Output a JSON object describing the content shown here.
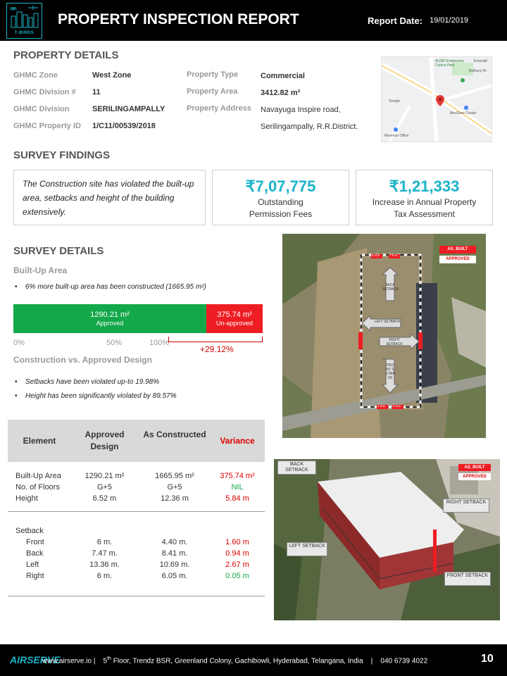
{
  "header": {
    "logo_text": "T-BIRDS",
    "title": "PROPERTY INSPECTION REPORT",
    "report_date_label": "Report Date:",
    "report_date": "19/01/2019"
  },
  "property_details": {
    "heading": "PROPERTY DETAILS",
    "left": [
      {
        "label": "GHMC Zone",
        "value": "West Zone"
      },
      {
        "label": "GHMC Division  #",
        "value": "11"
      },
      {
        "label": "GHMC Division",
        "value": "SERILINGAMPALLY"
      },
      {
        "label": "GHMC Property ID",
        "value": "1/C11/00539/2018"
      }
    ],
    "right": [
      {
        "label": "Property Type",
        "value": "Commercial"
      },
      {
        "label": "Property Area",
        "value": "3412.82 m²"
      },
      {
        "label": "Property Address",
        "value": "Navayuga Inspire road,",
        "value2": "Serilingampally, R.R.District."
      }
    ],
    "map": {
      "labels": [
        "ALIND Employees Colony Park",
        "Emerald",
        "Bethany Hi",
        "MedSave Center",
        "Revenue Office",
        "Temple"
      ]
    }
  },
  "survey_findings": {
    "heading": "SURVEY FINDINGS",
    "text": "The Construction  site has violated the built-up area,  setbacks and height of the building extensively.",
    "fees_value": "₹7,07,775",
    "fees_label_1": "Outstanding",
    "fees_label_2": "Permission Fees",
    "tax_value": "₹1,21,333",
    "tax_label_1": "Increase in Annual Property",
    "tax_label_2": "Tax Assessment"
  },
  "survey_details": {
    "heading": "SURVEY DETAILS",
    "built_up_title": "Built-Up  Area",
    "built_up_bullet": "6% more built-up area has been constructed  (1665.95 m²)",
    "bar": {
      "approved_value": "1290.21 m²",
      "approved_label": "Approved",
      "unapproved_value": "375.74 m²",
      "unapproved_label": "Un-approved",
      "approved_fraction": 0.774,
      "tick_0": "0%",
      "tick_50": "50%",
      "tick_100": "100%",
      "excess": "+29.12%"
    },
    "construction_title": "Construction  vs. Approved Design",
    "bullet_setbacks": "Setbacks have been violated up-to 19.98%",
    "bullet_height": "Height has been significantly violated by 89.57%"
  },
  "table": {
    "headers": [
      "Element",
      "Approved Design",
      "As Constructed",
      "Variance"
    ],
    "rows": [
      {
        "element": "Built-Up Area",
        "approved": "1290.21 m²",
        "constructed": "1665.95 m²",
        "variance": "375.74 m²",
        "status": "red"
      },
      {
        "element": "No. of Floors",
        "approved": "G+5",
        "constructed": "G+5",
        "variance": "NIL",
        "status": "green"
      },
      {
        "element": "Height",
        "approved": "6.52 m",
        "constructed": "12.36 m",
        "variance": "5.84 m",
        "status": "red"
      }
    ],
    "setback_label": "Setback",
    "setbacks": [
      {
        "element": "Front",
        "approved": "6 m.",
        "constructed": "4.40 m.",
        "variance": "1.60 m",
        "status": "red"
      },
      {
        "element": "Back",
        "approved": "7.47 m.",
        "constructed": "8.41 m.",
        "variance": "0.94 m",
        "status": "red"
      },
      {
        "element": "Left",
        "approved": "13.36 m.",
        "constructed": "10.69 m.",
        "variance": "2.67 m",
        "status": "red"
      },
      {
        "element": "Right",
        "approved": "6 m.",
        "constructed": "6.05 m.",
        "variance": "0.05 m",
        "status": "green"
      }
    ]
  },
  "photo1": {
    "legend_as_built": "AS_BUILT",
    "legend_approved": "APPROVED",
    "back_setback": "BACK SETBACK",
    "left_setback": "LEFT SETBACK",
    "right_setback": "RIGHT SETBACK",
    "front_setback": "FRONT SETBACK",
    "dim_top_a": "8.41m",
    "dim_top_b": "7.47m",
    "dim_bottom_a": "4.40m",
    "dim_bottom_b": "6.00m"
  },
  "photo2": {
    "legend_as_built": "AS_BUILT",
    "legend_approved": "APPROVED",
    "back_setback": "BACK SETBACK",
    "right_setback": "RIGHT SETBACK",
    "left_setback": "LEFT SETBACK",
    "front_setback": "FRONT SETBACK"
  },
  "footer": {
    "logo": "AIRSERVE",
    "website": "www.airserve.io",
    "floor_num": "5",
    "floor_sup": "th",
    "address": "Floor, Trendz BSR, Greenland Colony, Gachibowli, Hyderabad, Telangana, India",
    "phone": "040 6739 4022",
    "page": "10"
  },
  "colors": {
    "accent": "#1bb3c9",
    "approved_green": "#13a84a",
    "unapproved_red": "#ee1d23",
    "header_bg": "#000000"
  }
}
